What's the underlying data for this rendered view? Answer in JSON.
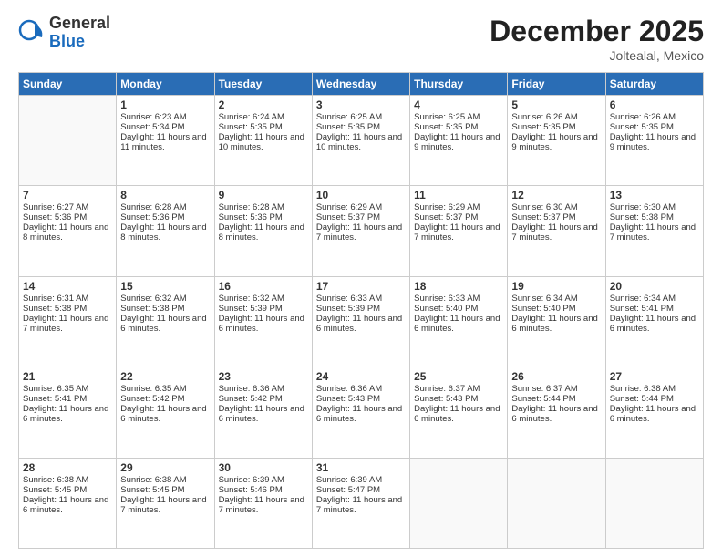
{
  "header": {
    "logo_general": "General",
    "logo_blue": "Blue",
    "month_title": "December 2025",
    "location": "Joltealal, Mexico"
  },
  "weekdays": [
    "Sunday",
    "Monday",
    "Tuesday",
    "Wednesday",
    "Thursday",
    "Friday",
    "Saturday"
  ],
  "weeks": [
    [
      {
        "day": "",
        "content": ""
      },
      {
        "day": "1",
        "content": "Sunrise: 6:23 AM\nSunset: 5:34 PM\nDaylight: 11 hours and 11 minutes."
      },
      {
        "day": "2",
        "content": "Sunrise: 6:24 AM\nSunset: 5:35 PM\nDaylight: 11 hours and 10 minutes."
      },
      {
        "day": "3",
        "content": "Sunrise: 6:25 AM\nSunset: 5:35 PM\nDaylight: 11 hours and 10 minutes."
      },
      {
        "day": "4",
        "content": "Sunrise: 6:25 AM\nSunset: 5:35 PM\nDaylight: 11 hours and 9 minutes."
      },
      {
        "day": "5",
        "content": "Sunrise: 6:26 AM\nSunset: 5:35 PM\nDaylight: 11 hours and 9 minutes."
      },
      {
        "day": "6",
        "content": "Sunrise: 6:26 AM\nSunset: 5:35 PM\nDaylight: 11 hours and 9 minutes."
      }
    ],
    [
      {
        "day": "7",
        "content": "Sunrise: 6:27 AM\nSunset: 5:36 PM\nDaylight: 11 hours and 8 minutes."
      },
      {
        "day": "8",
        "content": "Sunrise: 6:28 AM\nSunset: 5:36 PM\nDaylight: 11 hours and 8 minutes."
      },
      {
        "day": "9",
        "content": "Sunrise: 6:28 AM\nSunset: 5:36 PM\nDaylight: 11 hours and 8 minutes."
      },
      {
        "day": "10",
        "content": "Sunrise: 6:29 AM\nSunset: 5:37 PM\nDaylight: 11 hours and 7 minutes."
      },
      {
        "day": "11",
        "content": "Sunrise: 6:29 AM\nSunset: 5:37 PM\nDaylight: 11 hours and 7 minutes."
      },
      {
        "day": "12",
        "content": "Sunrise: 6:30 AM\nSunset: 5:37 PM\nDaylight: 11 hours and 7 minutes."
      },
      {
        "day": "13",
        "content": "Sunrise: 6:30 AM\nSunset: 5:38 PM\nDaylight: 11 hours and 7 minutes."
      }
    ],
    [
      {
        "day": "14",
        "content": "Sunrise: 6:31 AM\nSunset: 5:38 PM\nDaylight: 11 hours and 7 minutes."
      },
      {
        "day": "15",
        "content": "Sunrise: 6:32 AM\nSunset: 5:38 PM\nDaylight: 11 hours and 6 minutes."
      },
      {
        "day": "16",
        "content": "Sunrise: 6:32 AM\nSunset: 5:39 PM\nDaylight: 11 hours and 6 minutes."
      },
      {
        "day": "17",
        "content": "Sunrise: 6:33 AM\nSunset: 5:39 PM\nDaylight: 11 hours and 6 minutes."
      },
      {
        "day": "18",
        "content": "Sunrise: 6:33 AM\nSunset: 5:40 PM\nDaylight: 11 hours and 6 minutes."
      },
      {
        "day": "19",
        "content": "Sunrise: 6:34 AM\nSunset: 5:40 PM\nDaylight: 11 hours and 6 minutes."
      },
      {
        "day": "20",
        "content": "Sunrise: 6:34 AM\nSunset: 5:41 PM\nDaylight: 11 hours and 6 minutes."
      }
    ],
    [
      {
        "day": "21",
        "content": "Sunrise: 6:35 AM\nSunset: 5:41 PM\nDaylight: 11 hours and 6 minutes."
      },
      {
        "day": "22",
        "content": "Sunrise: 6:35 AM\nSunset: 5:42 PM\nDaylight: 11 hours and 6 minutes."
      },
      {
        "day": "23",
        "content": "Sunrise: 6:36 AM\nSunset: 5:42 PM\nDaylight: 11 hours and 6 minutes."
      },
      {
        "day": "24",
        "content": "Sunrise: 6:36 AM\nSunset: 5:43 PM\nDaylight: 11 hours and 6 minutes."
      },
      {
        "day": "25",
        "content": "Sunrise: 6:37 AM\nSunset: 5:43 PM\nDaylight: 11 hours and 6 minutes."
      },
      {
        "day": "26",
        "content": "Sunrise: 6:37 AM\nSunset: 5:44 PM\nDaylight: 11 hours and 6 minutes."
      },
      {
        "day": "27",
        "content": "Sunrise: 6:38 AM\nSunset: 5:44 PM\nDaylight: 11 hours and 6 minutes."
      }
    ],
    [
      {
        "day": "28",
        "content": "Sunrise: 6:38 AM\nSunset: 5:45 PM\nDaylight: 11 hours and 6 minutes."
      },
      {
        "day": "29",
        "content": "Sunrise: 6:38 AM\nSunset: 5:45 PM\nDaylight: 11 hours and 7 minutes."
      },
      {
        "day": "30",
        "content": "Sunrise: 6:39 AM\nSunset: 5:46 PM\nDaylight: 11 hours and 7 minutes."
      },
      {
        "day": "31",
        "content": "Sunrise: 6:39 AM\nSunset: 5:47 PM\nDaylight: 11 hours and 7 minutes."
      },
      {
        "day": "",
        "content": ""
      },
      {
        "day": "",
        "content": ""
      },
      {
        "day": "",
        "content": ""
      }
    ]
  ]
}
